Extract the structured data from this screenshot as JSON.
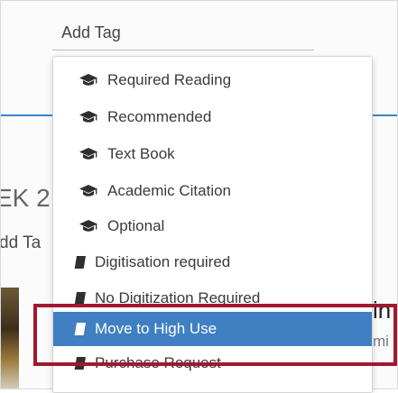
{
  "add_tag_input": {
    "placeholder": "Add Tag"
  },
  "background": {
    "week_heading_fragment": "EK 2",
    "add_tag_link_fragment": "dd Ta",
    "right_text_1": "in",
    "right_text_2": "mi"
  },
  "tag_menu": {
    "items": [
      {
        "label": "Required Reading",
        "icon": "graduation-cap-icon"
      },
      {
        "label": "Recommended",
        "icon": "graduation-cap-icon"
      },
      {
        "label": "Text Book",
        "icon": "graduation-cap-icon"
      },
      {
        "label": "Academic Citation",
        "icon": "graduation-cap-icon"
      },
      {
        "label": "Optional",
        "icon": "graduation-cap-icon"
      },
      {
        "label": "Digitisation required",
        "icon": "book-icon"
      },
      {
        "label": "No Digitization Required",
        "icon": "book-icon"
      },
      {
        "label": "Move to High Use",
        "icon": "book-icon"
      },
      {
        "label": "Purchase Request",
        "icon": "book-icon"
      }
    ],
    "active_item": "Move to High Use"
  },
  "colors": {
    "accent_blue": "#3f7fc2",
    "highlight_red": "#a0192e",
    "divider_blue": "#3a86c8"
  }
}
